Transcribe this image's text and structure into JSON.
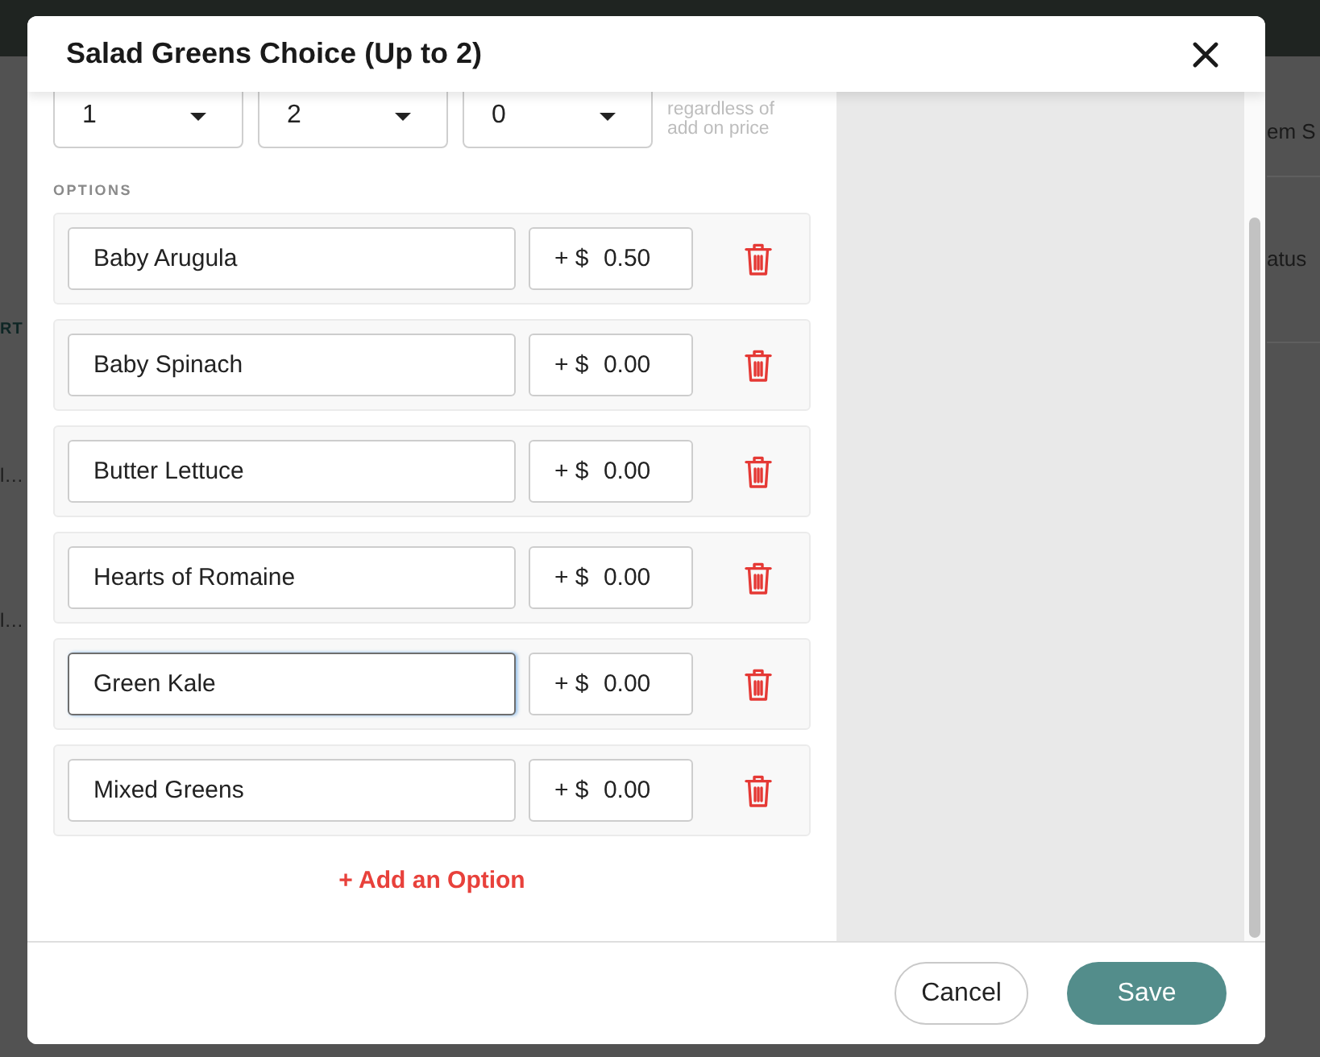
{
  "background": {
    "left_texts": [
      {
        "text": "RT",
        "kind": "heading"
      },
      {
        "text": "l…",
        "kind": "cell"
      },
      {
        "text": "l…",
        "kind": "cell"
      }
    ],
    "right_texts": [
      {
        "text": "em S",
        "kind": "heading"
      },
      {
        "text": "atus",
        "kind": "cell"
      }
    ]
  },
  "dialog": {
    "title": "Salad Greens Choice (Up to 2)"
  },
  "dropdowns": [
    {
      "value": "1"
    },
    {
      "value": "2"
    },
    {
      "value": "0"
    }
  ],
  "free_options_note": "regardless of add on price",
  "options_label": "OPTIONS",
  "options": [
    {
      "name": "Baby Arugula",
      "price_prefix": "+ $",
      "price": "0.50",
      "focused": false
    },
    {
      "name": "Baby Spinach",
      "price_prefix": "+ $",
      "price": "0.00",
      "focused": false
    },
    {
      "name": "Butter Lettuce",
      "price_prefix": "+ $",
      "price": "0.00",
      "focused": false
    },
    {
      "name": "Hearts of Romaine",
      "price_prefix": "+ $",
      "price": "0.00",
      "focused": false
    },
    {
      "name": "Green Kale",
      "price_prefix": "+ $",
      "price": "0.00",
      "focused": true
    },
    {
      "name": "Mixed Greens",
      "price_prefix": "+ $",
      "price": "0.00",
      "focused": false
    }
  ],
  "add_option": "+ Add an Option",
  "buttons": [
    {
      "label": "Cancel",
      "kind": "secondary"
    },
    {
      "label": "Save",
      "kind": "primary"
    }
  ]
}
